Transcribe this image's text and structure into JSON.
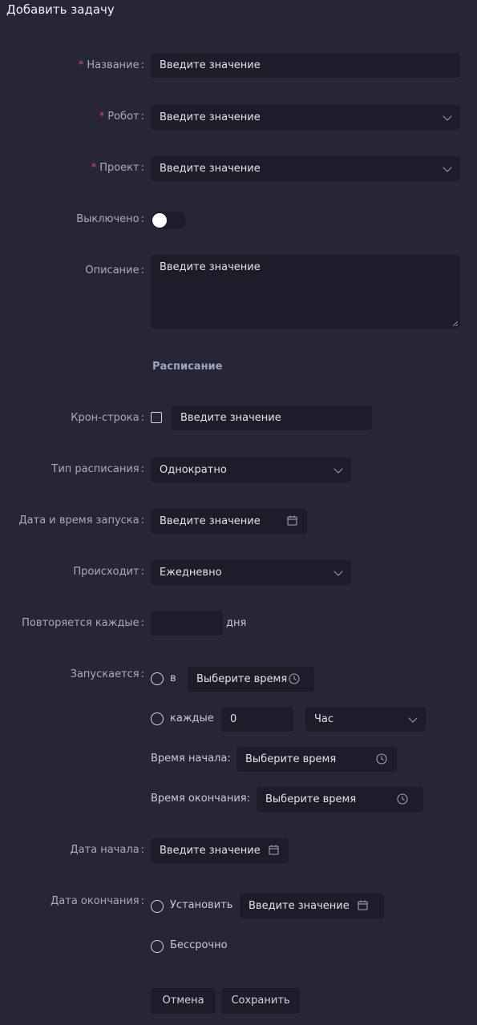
{
  "dialog": {
    "title": "Добавить задачу"
  },
  "form": {
    "name": {
      "label": "Название",
      "placeholder": "Введите значение"
    },
    "robot": {
      "label": "Робот",
      "placeholder": "Введите значение"
    },
    "project": {
      "label": "Проект",
      "placeholder": "Введите значение"
    },
    "disabled": {
      "label": "Выключено",
      "value": false
    },
    "description": {
      "label": "Описание",
      "placeholder": "Введите значение"
    }
  },
  "schedule": {
    "section_title": "Расписание",
    "cron": {
      "label": "Крон-строка",
      "placeholder": "Введите значение"
    },
    "type": {
      "label": "Тип расписания",
      "value": "Однократно"
    },
    "launch_datetime": {
      "label": "Дата и время запуска",
      "placeholder": "Введите значение"
    },
    "occurs": {
      "label": "Происходит",
      "value": "Ежедневно"
    },
    "repeat": {
      "label": "Повторяется каждые",
      "unit": "дня"
    },
    "runs": {
      "label": "Запускается",
      "at_label": "в",
      "at_placeholder": "Выберите время",
      "every_label": "каждые",
      "every_value": "0",
      "every_unit": "Час",
      "start_time_label": "Время начала:",
      "start_time_placeholder": "Выберите время",
      "end_time_label": "Время окончания:",
      "end_time_placeholder": "Выберите время"
    },
    "start_date": {
      "label": "Дата начала",
      "placeholder": "Введите значение"
    },
    "end_date": {
      "label": "Дата окончания",
      "set_label": "Установить",
      "placeholder": "Введите значение",
      "never_label": "Бессрочно"
    }
  },
  "buttons": {
    "cancel": "Отмена",
    "save": "Сохранить"
  },
  "colors": {
    "background": "#262637",
    "input": "#1c1c2a",
    "required": "#e5484d",
    "section": "#9fa3c4"
  },
  "icons": [
    "chevron-down-icon",
    "calendar-icon",
    "clock-icon",
    "resize-grip-icon"
  ]
}
